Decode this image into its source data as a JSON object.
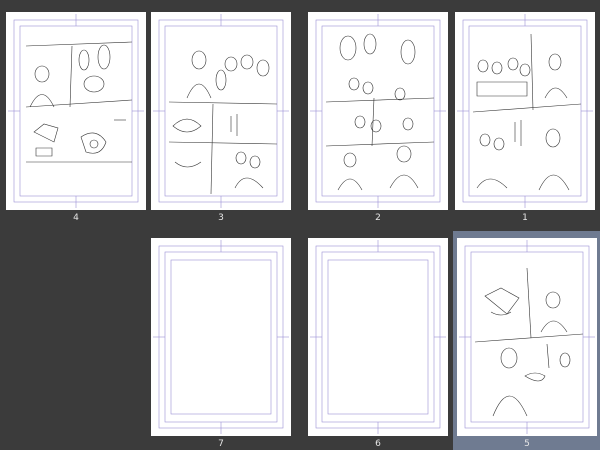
{
  "pages": [
    {
      "id": "p4",
      "number": "4",
      "kind": "sketch"
    },
    {
      "id": "p3",
      "number": "3",
      "kind": "sketch"
    },
    {
      "id": "p2",
      "number": "2",
      "kind": "sketch"
    },
    {
      "id": "p1",
      "number": "1",
      "kind": "sketch"
    },
    {
      "id": "p7",
      "number": "7",
      "kind": "blank"
    },
    {
      "id": "p6",
      "number": "6",
      "kind": "blank"
    },
    {
      "id": "p5",
      "number": "5",
      "kind": "sketch",
      "selected": true
    }
  ],
  "colors": {
    "background": "#3b3b3b",
    "page": "#ffffff",
    "guide": "#9b8fd6",
    "sketch": "#333333",
    "selection": "#6f7b91"
  }
}
